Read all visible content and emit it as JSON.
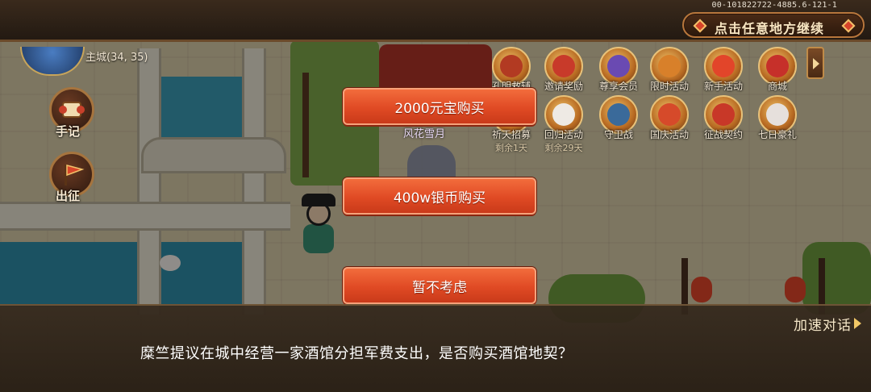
{
  "trace_id": "00-101822722-4885.6-121-1",
  "top_bar": {
    "continue_prompt": "点击任意地方继续"
  },
  "left_panel": {
    "city_label": "主城(34, 35)",
    "buttons": [
      {
        "label": "手记",
        "icon": "scroll-icon"
      },
      {
        "label": "出征",
        "icon": "flag-icon"
      }
    ]
  },
  "activities_row1": [
    {
      "label": "孔明救辅",
      "sub": ""
    },
    {
      "label": "邀请奖励",
      "sub": ""
    },
    {
      "label": "尊享会员",
      "sub": ""
    },
    {
      "label": "限时活动",
      "sub": ""
    },
    {
      "label": "新手活动",
      "sub": ""
    },
    {
      "label": "商城",
      "sub": ""
    }
  ],
  "activities_row2": [
    {
      "label": "祈天招募",
      "sub": "剩余1天"
    },
    {
      "label": "回归活动",
      "sub": "剩余29天"
    },
    {
      "label": "守卫战",
      "sub": ""
    },
    {
      "label": "国庆活动",
      "sub": ""
    },
    {
      "label": "征战契约",
      "sub": ""
    },
    {
      "label": "七日豪礼",
      "sub": ""
    }
  ],
  "npc_name": "风花雪月",
  "choices": [
    {
      "label": "2000元宝购买"
    },
    {
      "label": "400w银币购买"
    },
    {
      "label": "暂不考虑"
    }
  ],
  "dialog": {
    "speed_label": "加速对话",
    "text": "糜竺提议在城中经营一家酒馆分担军费支出，是否购买酒馆地契？"
  },
  "colors": {
    "button_red": "#e04a24",
    "button_border": "#f6a27a",
    "dialog_bg": "#34281c",
    "gold": "#f2c866"
  }
}
